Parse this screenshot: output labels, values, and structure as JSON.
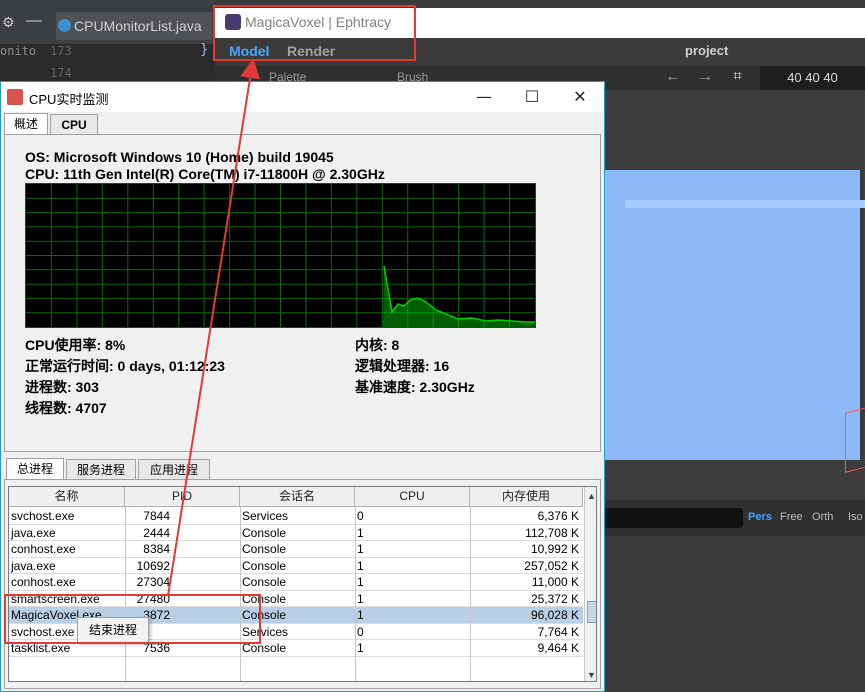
{
  "ide": {
    "tab_label": "CPUMonitorList.java",
    "line_numbers": [
      "173",
      "174"
    ],
    "brace": "}",
    "left_text": "onito"
  },
  "magicavoxel": {
    "window_title": "MagicaVoxel | Ephtracy",
    "menu_model": "Model",
    "menu_render": "Render",
    "project_label": "project",
    "palette_label": "Palette",
    "brush_label": "Brush",
    "size_readout": "40  40  40",
    "view_modes": [
      "Pers",
      "Free",
      "Orth",
      "Iso"
    ],
    "colors": {
      "model_active": "#4aa3ff",
      "cube": "#8cb8f5",
      "viewport_bg": "#3c3c3c"
    }
  },
  "monitor": {
    "title": "CPU实时监测",
    "top_tabs": [
      "概述",
      "CPU"
    ],
    "os_line": "OS:  Microsoft Windows 10 (Home) build 19045",
    "cpu_line": "CPU:  11th Gen Intel(R) Core(TM) i7-11800H @ 2.30GHz",
    "stats_left": [
      "CPU使用率: 8%",
      "正常运行时间:  0 days, 01:12:23",
      "进程数: 303",
      "线程数: 4707"
    ],
    "stats_right": [
      "内核:  8",
      "逻辑处理器:  16",
      "基准速度:  2.30GHz"
    ],
    "process_tabs": [
      "总进程",
      "服务进程",
      "应用进程"
    ],
    "columns": [
      "名称",
      "PID",
      "会话名",
      "CPU",
      "内存使用"
    ],
    "rows": [
      [
        "svchost.exe",
        "7844",
        "Services",
        "0",
        "6,376 K"
      ],
      [
        "java.exe",
        "2444",
        "Console",
        "1",
        "112,708 K"
      ],
      [
        "conhost.exe",
        "8384",
        "Console",
        "1",
        "10,992 K"
      ],
      [
        "java.exe",
        "10692",
        "Console",
        "1",
        "257,052 K"
      ],
      [
        "conhost.exe",
        "27304",
        "Console",
        "1",
        "11,000 K"
      ],
      [
        "smartscreen.exe",
        "27480",
        "Console",
        "1",
        "25,372 K"
      ],
      [
        "MagicaVoxel.exe",
        "3872",
        "Console",
        "1",
        "96,028 K"
      ],
      [
        "svchost.exe",
        "",
        "Services",
        "0",
        "7,764 K"
      ],
      [
        "tasklist.exe",
        "7536",
        "Console",
        "1",
        "9,464 K"
      ]
    ],
    "selected_row": 6,
    "context_menu": [
      "结束进程"
    ],
    "graph_color": "#00d000"
  }
}
